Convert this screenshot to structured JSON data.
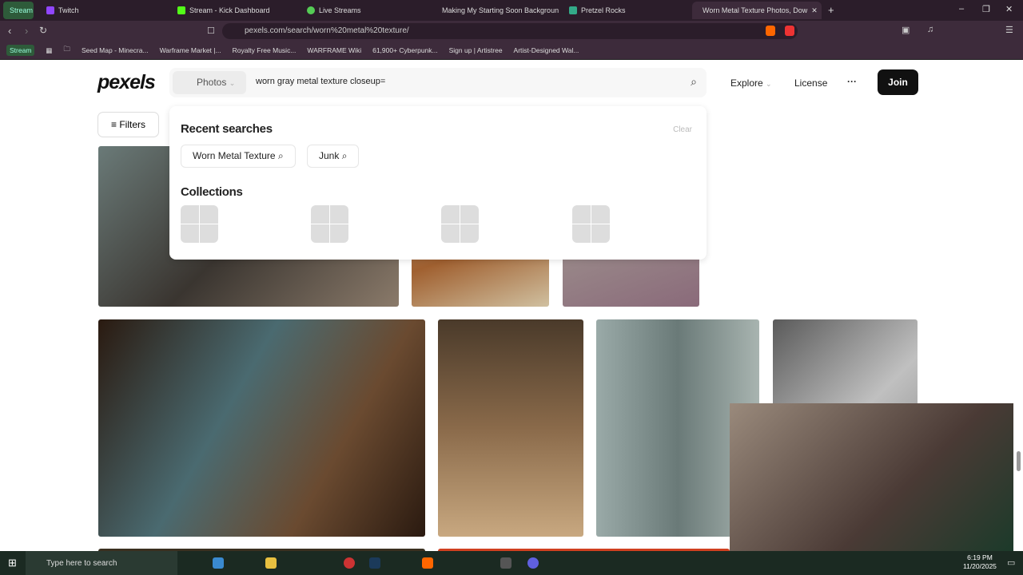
{
  "browser": {
    "tabs": [
      {
        "label": "Stream"
      },
      {
        "label": "Twitch"
      },
      {
        "label": "Stream - Kick Dashboard"
      },
      {
        "label": "Live Streams"
      },
      {
        "label": "Making My Starting Soon Backgroun"
      },
      {
        "label": "Pretzel Rocks"
      },
      {
        "label": "Worn Metal Texture Photos, Dow"
      }
    ],
    "url": "pexels.com/search/worn%20metal%20texture/",
    "bookmarks": [
      "Stream",
      "Seed Map - Minecra...",
      "Warframe Market |...",
      "Royalty Free Music...",
      "WARFRAME Wiki",
      "61,900+ Cyberpunk...",
      "Sign up | Artistree",
      "Artist-Designed Wal..."
    ]
  },
  "header": {
    "logo": "pexels",
    "type": "Photos",
    "query": "worn gray metal texture closeup=",
    "explore": "Explore",
    "license": "License",
    "more": "···",
    "join": "Join"
  },
  "filters": "Filters",
  "dropdown": {
    "recent_title": "Recent searches",
    "clear": "Clear",
    "recent": [
      "Worn Metal Texture",
      "Junk"
    ],
    "collections_title": "Collections"
  },
  "taskbar": {
    "search": "Type here to search",
    "time": "6:19 PM",
    "date": "11/20/2025"
  }
}
